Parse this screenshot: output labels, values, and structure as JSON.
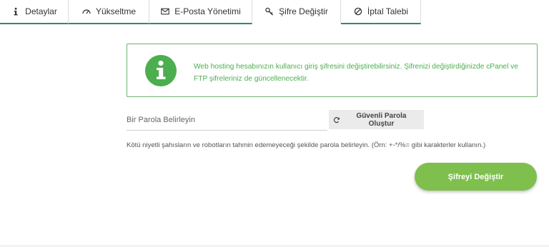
{
  "tabs": [
    {
      "label": "Detaylar",
      "icon": "info-icon"
    },
    {
      "label": "Yükseltme",
      "icon": "gauge-icon"
    },
    {
      "label": "E-Posta Yönetimi",
      "icon": "envelope-icon"
    },
    {
      "label": "Şifre Değiştir",
      "icon": "key-icon"
    },
    {
      "label": "İptal Talebi",
      "icon": "ban-icon"
    }
  ],
  "active_tab": "Şifre Değiştir",
  "alert": {
    "text": "Web hosting hesabınızın kullanıcı giriş şifresini değiştirebilirsiniz. Şifrenizi değiştirdiğinizde cPanel ve FTP şifreleriniz de güncellenecektir."
  },
  "password": {
    "placeholder": "Bir Parola Belirleyin",
    "generate_label": "Güvenli Parola Oluştur"
  },
  "hint": "Kötü niyetli şahısların ve robotların tahmin edemeyeceği şekilde parola belirleyin. (Örn: +-*/%= gibi karakterler kullanın.)",
  "submit_label": "Şifreyi Değiştir",
  "colors": {
    "accent_tab": "#2f8b6f",
    "alert_green": "#4cae4f",
    "button_green": "#7fbf4d"
  }
}
